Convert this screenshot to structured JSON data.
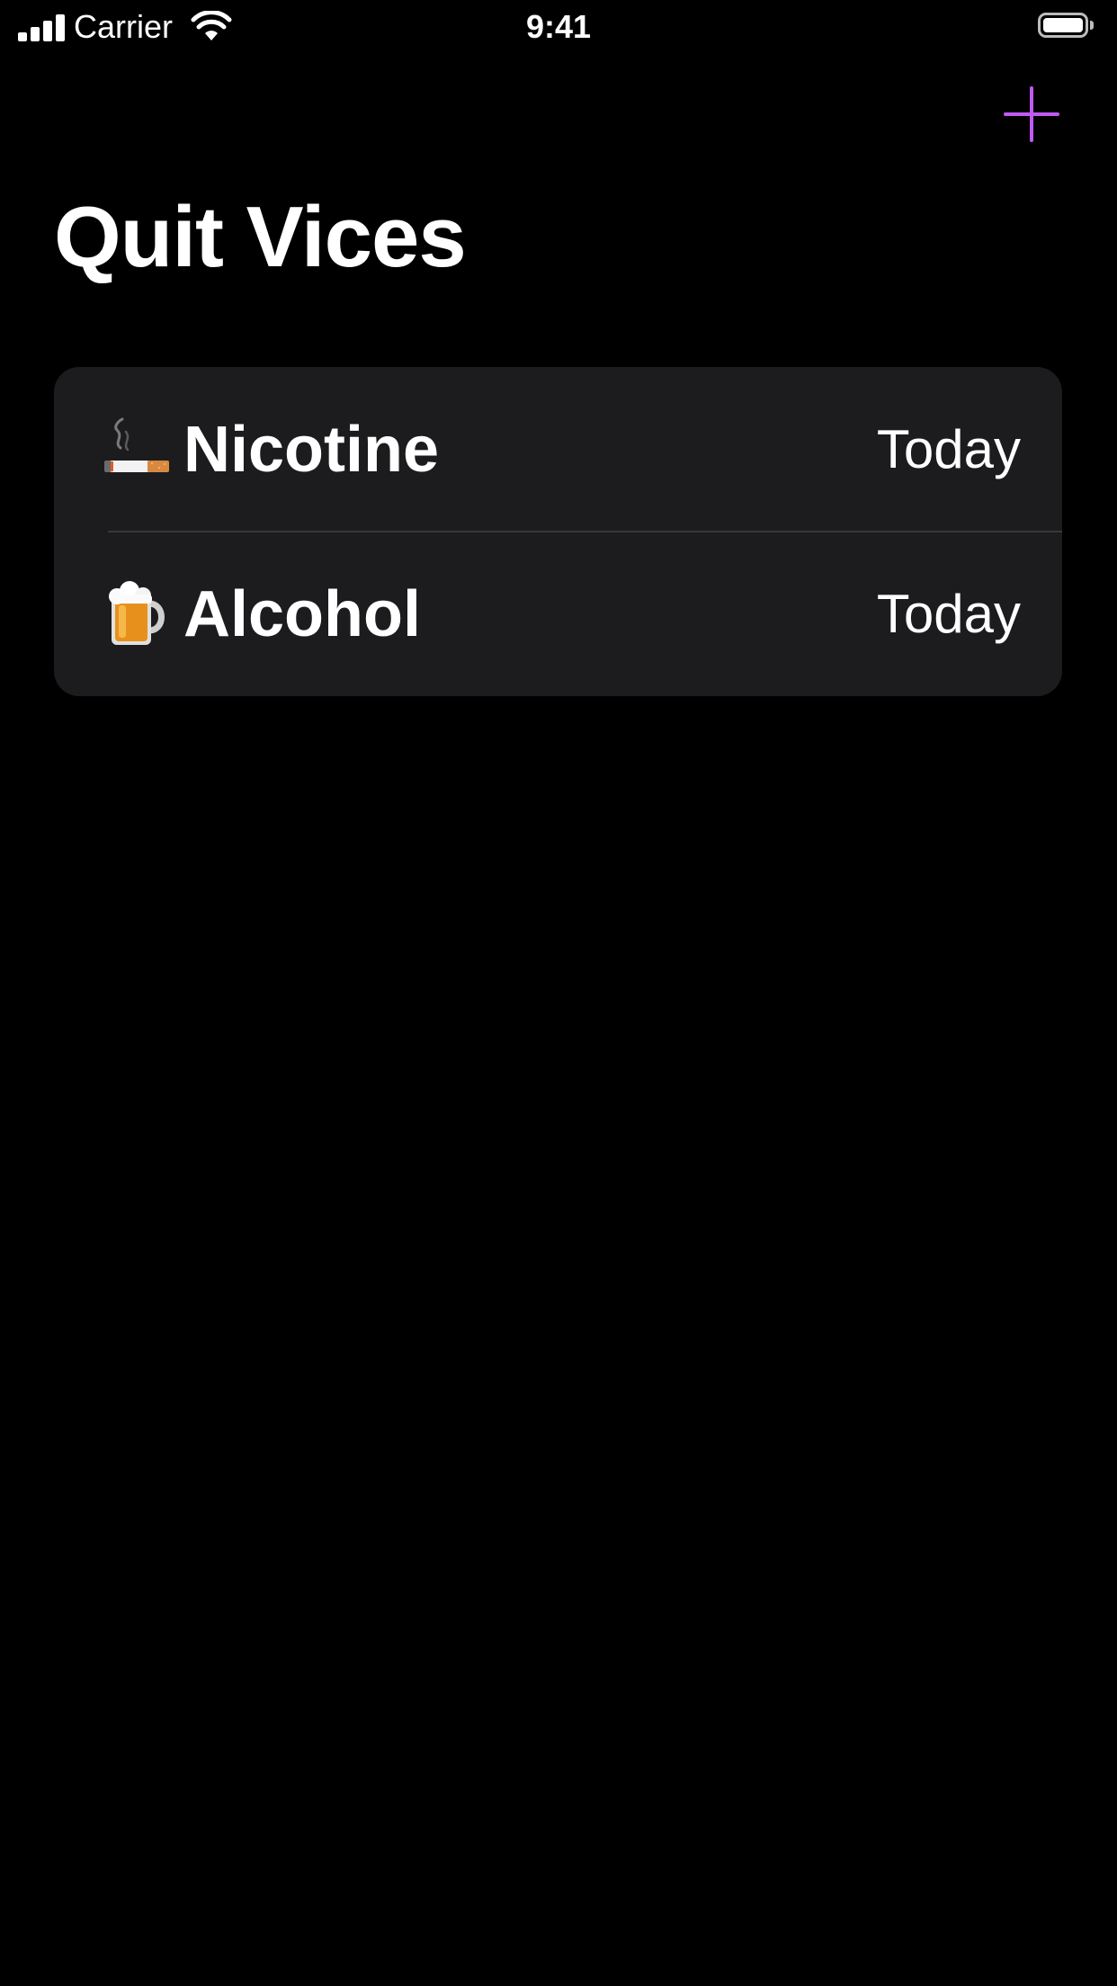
{
  "status_bar": {
    "carrier": "Carrier",
    "time": "9:41"
  },
  "nav": {
    "add_icon": "plus-icon",
    "accent_color": "#bf5af2"
  },
  "page": {
    "title": "Quit Vices"
  },
  "vices": [
    {
      "icon": "cigarette-icon",
      "name": "Nicotine",
      "date": "Today"
    },
    {
      "icon": "beer-mug-icon",
      "name": "Alcohol",
      "date": "Today"
    }
  ],
  "colors": {
    "background": "#000000",
    "card": "#1c1c1e",
    "separator": "#38383a",
    "text": "#ffffff"
  }
}
